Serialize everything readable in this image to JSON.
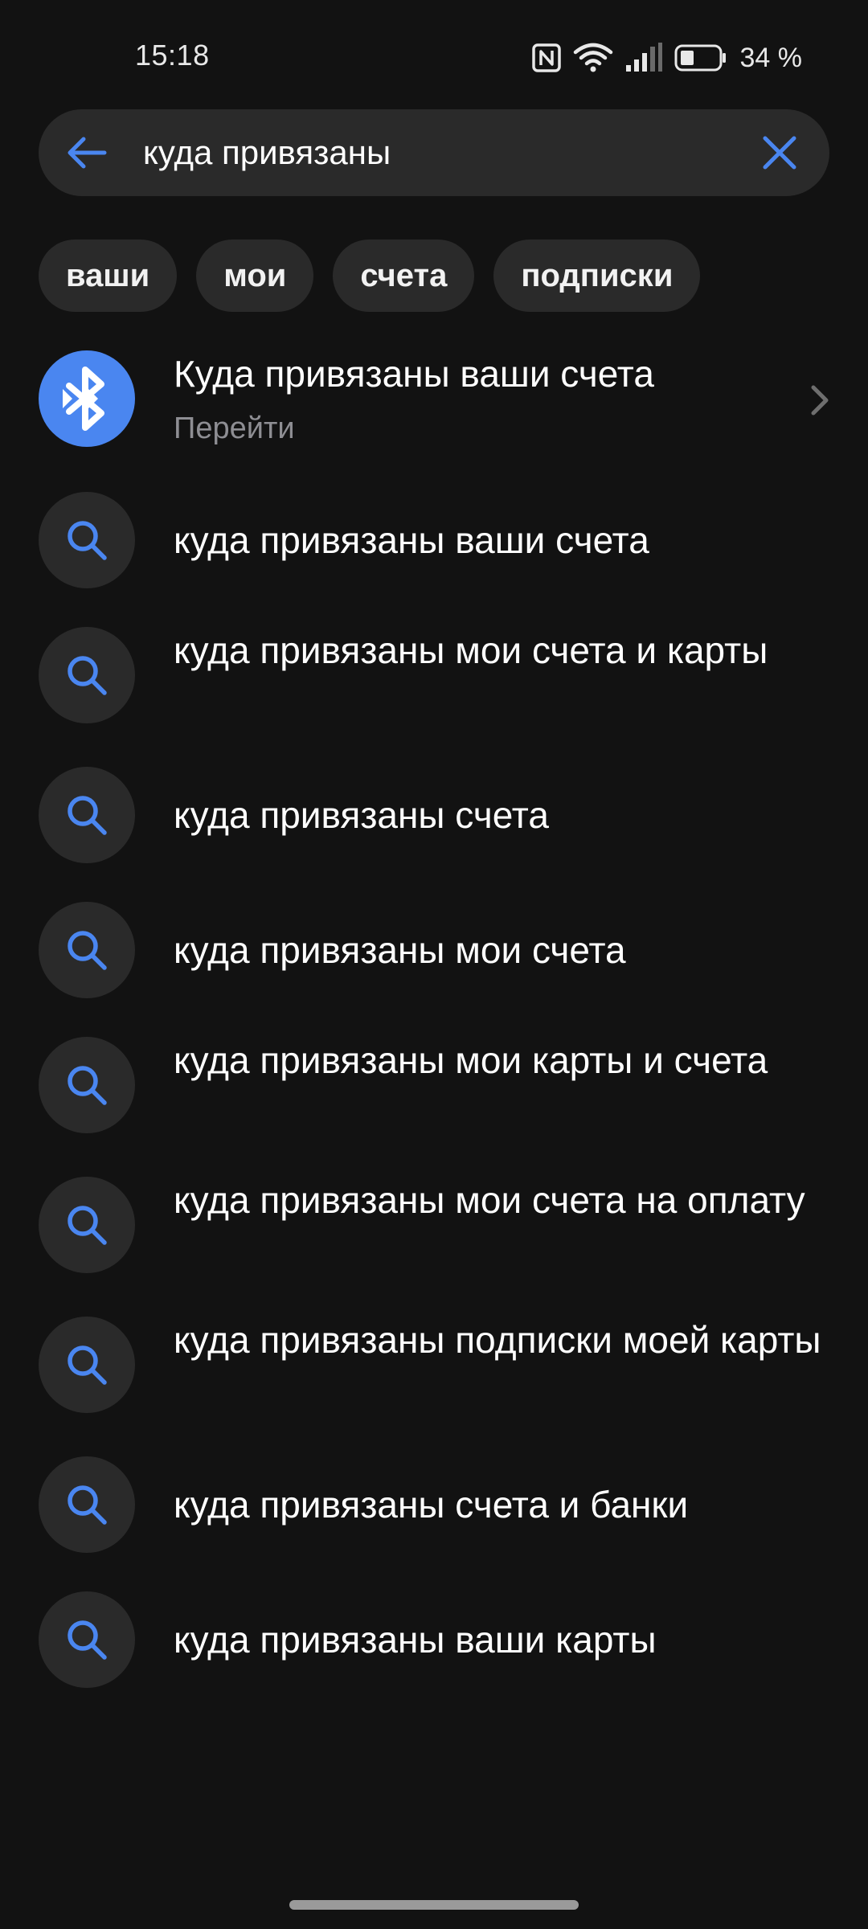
{
  "status_bar": {
    "time": "15:18",
    "battery": "34 %",
    "icons": [
      "nfc-icon",
      "wifi-icon",
      "signal-icon",
      "battery-icon"
    ]
  },
  "search": {
    "value": "куда привязаны",
    "icons": [
      "back-arrow-icon",
      "close-icon"
    ]
  },
  "chips": [
    "ваши",
    "мои",
    "счета",
    "подписки"
  ],
  "app_result": {
    "title": "Куда привязаны ваши счета",
    "subtitle": "Перейти",
    "icon": "bluetooth-app-icon"
  },
  "suggestions": [
    "куда привязаны ваши счета",
    "куда привязаны мои счета и карты",
    "куда привязаны счета",
    "куда привязаны мои счета",
    "куда привязаны мои карты и счета",
    "куда привязаны мои счета на оплату",
    "куда привязаны подписки моей карты",
    "куда привязаны счета и банки",
    "куда привязаны ваши карты"
  ],
  "colors": {
    "background": "#121212",
    "surface": "#2a2a2a",
    "accent": "#4a86f0",
    "secondary_text": "#8e8e93"
  }
}
